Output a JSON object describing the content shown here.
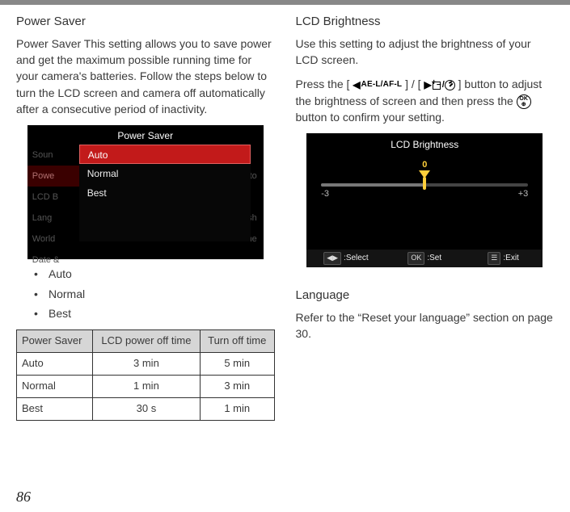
{
  "page_number": "86",
  "left": {
    "heading": "Power Saver",
    "para": "Power Saver This setting allows you to save power and get the maximum possible running time for your camera's batteries. Follow the steps below to turn the LCD screen and camera off automatically after a consecutive period of inactivity.",
    "bullets": [
      "Auto",
      "Normal",
      "Best"
    ],
    "table": {
      "headers": [
        "Power Saver",
        "LCD power off time",
        "Turn off time"
      ],
      "rows": [
        [
          "Auto",
          "3 min",
          "5 min"
        ],
        [
          "Normal",
          "1 min",
          "3 min"
        ],
        [
          "Best",
          "30 s",
          "1 min"
        ]
      ]
    },
    "cam": {
      "title": "Power Saver",
      "side": [
        "Soun",
        "Powe",
        "LCD B",
        "Lang",
        "World",
        "Date &"
      ],
      "side_right": [
        "",
        "Auto",
        "",
        "glish",
        "ome",
        ""
      ],
      "menu": [
        "Auto",
        "Normal",
        "Best"
      ]
    }
  },
  "right": {
    "heading": "LCD Brightness",
    "para1": "Use this setting to adjust the brightness of your LCD screen.",
    "para2_pre": "Press the [ ",
    "btn_left": "AE-L/AF-L",
    "para2_mid": " ] / [ ",
    "para2_post1": " ] button to adjust the brightness of screen and then press the ",
    "ok_top": "OK",
    "ok_bottom": "⊕",
    "para2_post2": " button to confirm your setting.",
    "cam": {
      "title": "LCD Brightness",
      "value": "0",
      "left_end": "-3",
      "right_end": "+3",
      "footer": {
        "select": ":Select",
        "set": ":Set",
        "exit": ":Exit",
        "k1": "◀▶",
        "k2": "OK",
        "k3": "☰"
      }
    },
    "heading2": "Language",
    "para3": "Refer to the “Reset your language” section on page 30."
  }
}
